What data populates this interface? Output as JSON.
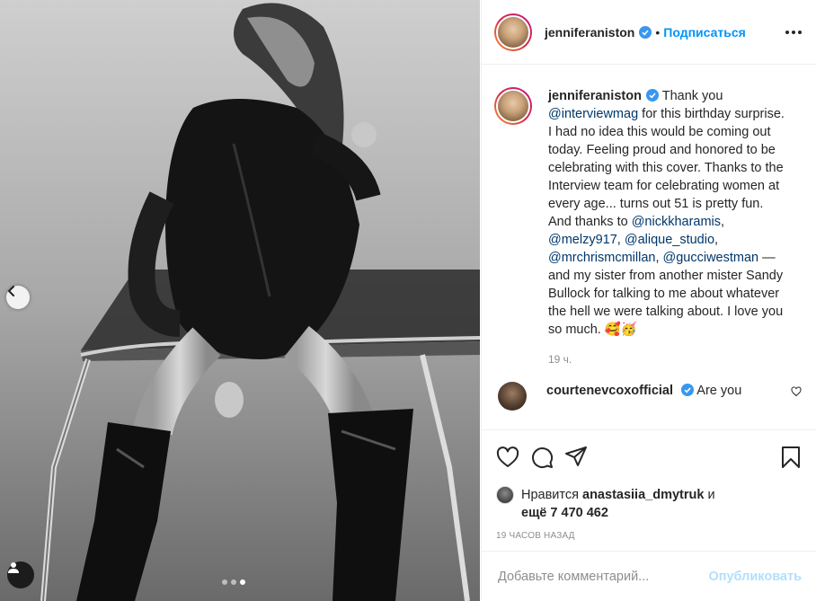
{
  "post": {
    "author": "jenniferaniston",
    "follow_label": "Подписаться",
    "separator": "•",
    "photo_alt": "Black and white photo",
    "carousel_dots": 3
  },
  "caption": {
    "author": "jenniferaniston",
    "text_1": "Thank you ",
    "mention_1": "@interviewmag",
    "text_2": " for this birthday surprise. I had no idea this would be coming out today. Feeling proud and honored to be celebrating with this cover. Thanks to the Interview team for celebrating women at every age... turns out 51 is pretty fun. And thanks to ",
    "mention_2": "@nickkharamis",
    "comma_1": ", ",
    "mention_3": "@melzy917",
    "comma_2": ", ",
    "mention_4": "@alique_studio",
    "comma_3": ", ",
    "mention_5": "@mrchrismcmillan",
    "comma_4": ", ",
    "mention_6": "@gucciwestman",
    "text_3": " — and my sister from another mister Sandy Bullock for talking to me about whatever the hell we were talking about. I love you so much. 🥰🥳",
    "time": "19 ч."
  },
  "reply": {
    "author": "courtenevcoxofficial",
    "text": "Are you"
  },
  "likes": {
    "prefix": "Нравится ",
    "user": "anastasiia_dmytruk",
    "mid": " и",
    "more_prefix": "ещё ",
    "count": "7 470 462"
  },
  "posted_ago": "19 часов назад",
  "comment_box": {
    "placeholder": "Добавьте комментарий...",
    "publish_label": "Опубликовать"
  },
  "colors": {
    "link": "#0095f6",
    "mention": "#00376b",
    "muted": "#8e8e8e"
  }
}
